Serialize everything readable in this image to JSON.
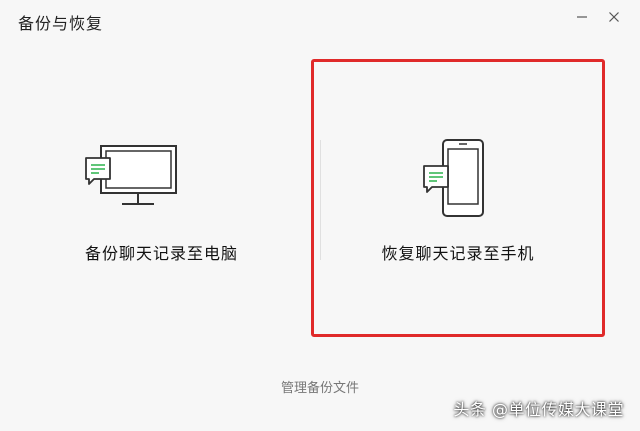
{
  "window": {
    "title": "备份与恢复"
  },
  "options": {
    "backup": {
      "label": "备份聊天记录至电脑",
      "icon": "computer-chat-icon"
    },
    "restore": {
      "label": "恢复聊天记录至手机",
      "icon": "phone-chat-icon",
      "highlighted": true
    }
  },
  "footer": {
    "manage_label": "管理备份文件"
  },
  "watermark": {
    "text": "头条 @单位传媒大课堂"
  },
  "colors": {
    "highlight_border": "#e02a2a",
    "chat_bubble_lines": "#2bb24c"
  }
}
